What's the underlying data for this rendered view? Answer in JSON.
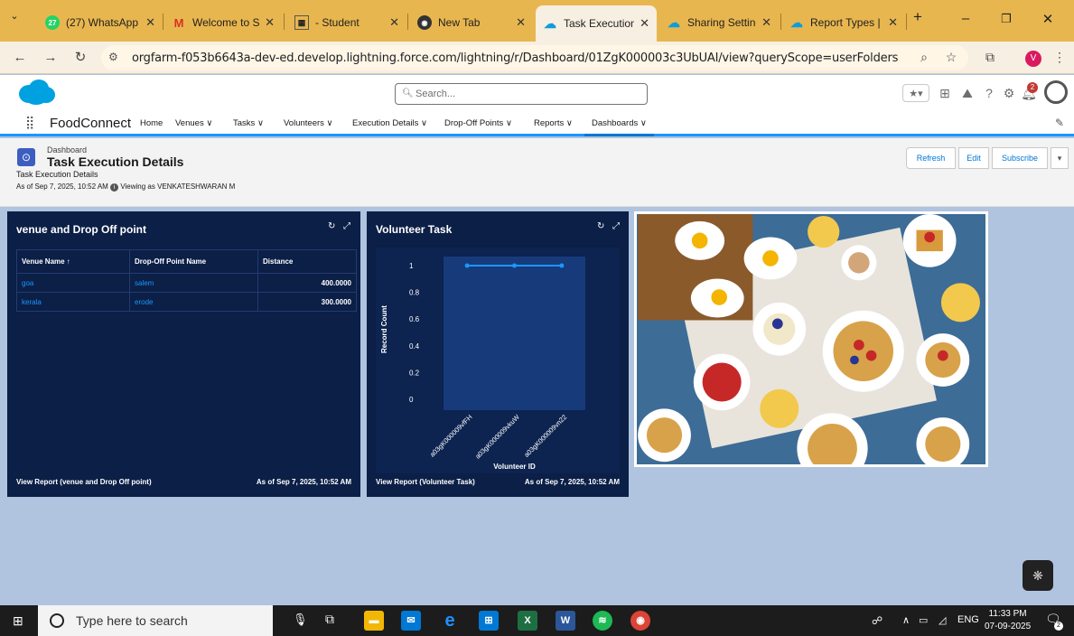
{
  "browser": {
    "tabs": [
      {
        "title": "(27) WhatsApp",
        "icon": "whatsapp-icon"
      },
      {
        "title": "Welcome to Sale",
        "icon": "gmail-icon"
      },
      {
        "title": "- Student",
        "icon": "doc-icon"
      },
      {
        "title": "New Tab",
        "icon": "chrome-icon"
      },
      {
        "title": "Task Execution D",
        "icon": "salesforce-icon",
        "active": true
      },
      {
        "title": "Sharing Settings",
        "icon": "salesforce-icon"
      },
      {
        "title": "Report Types | S",
        "icon": "salesforce-icon"
      }
    ],
    "url": "orgfarm-f053b6643a-dev-ed.develop.lightning.force.com/lightning/r/Dashboard/01ZgK000003c3UbUAI/view?queryScope=userFolders",
    "profile_initial": "V"
  },
  "sf": {
    "search_placeholder": "Search...",
    "notification_count": "2",
    "app_name": "FoodConnect",
    "nav": [
      "Home",
      "Venues",
      "Tasks",
      "Volunteers",
      "Execution Details",
      "Drop-Off Points",
      "Reports",
      "Dashboards"
    ],
    "active_nav": "Dashboards"
  },
  "dashboard": {
    "type_label": "Dashboard",
    "title": "Task Execution Details",
    "subtitle": "Task Execution Details",
    "as_of": "As of Sep 7, 2025, 10:52 AM",
    "viewing_as": "Viewing as VENKATESHWARAN M",
    "buttons": {
      "refresh": "Refresh",
      "edit": "Edit",
      "subscribe": "Subscribe"
    }
  },
  "card1": {
    "title": "venue and Drop Off point",
    "columns": [
      "Venue Name ↑",
      "Drop-Off Point Name",
      "Distance"
    ],
    "rows": [
      {
        "venue": "goa",
        "dropoff": "salem",
        "distance": "400.0000"
      },
      {
        "venue": "kerala",
        "dropoff": "erode",
        "distance": "300.0000"
      }
    ],
    "footer_link": "View Report (venue and Drop Off point)",
    "footer_time": "As of Sep 7, 2025, 10:52 AM"
  },
  "card2": {
    "title": "Volunteer Task",
    "footer_link": "View Report (Volunteer Task)",
    "footer_time": "As of Sep 7, 2025, 10:52 AM"
  },
  "chart_data": {
    "type": "line",
    "title": "Volunteer Task",
    "xlabel": "Volunteer ID",
    "ylabel": "Record Count",
    "categories": [
      "a03gK000009vfFH",
      "a03gK000009vkuW",
      "a03gK000009vn22"
    ],
    "values": [
      1,
      1,
      1
    ],
    "yticks": [
      "0",
      "0.2",
      "0.4",
      "0.6",
      "0.8",
      "1"
    ],
    "ylim": [
      0,
      1
    ],
    "grid": false,
    "color": "#1b96ff"
  },
  "taskbar": {
    "search_placeholder": "Type here to search",
    "lang": "ENG",
    "time": "11:33 PM",
    "date": "07-09-2025",
    "notif": "2"
  }
}
